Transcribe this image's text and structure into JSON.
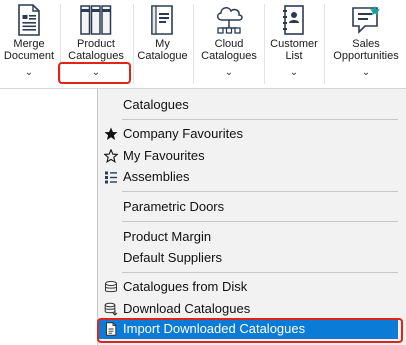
{
  "ribbon": {
    "buttons": [
      {
        "id": "merge",
        "label_line1": "Merge",
        "label_line2": "Document",
        "icon": "merge-document-icon"
      },
      {
        "id": "product",
        "label_line1": "Product",
        "label_line2": "Catalogues",
        "icon": "product-catalogues-icon"
      },
      {
        "id": "my",
        "label_line1": "My",
        "label_line2": "Catalogue",
        "icon": "my-catalogue-icon"
      },
      {
        "id": "cloud",
        "label_line1": "Cloud",
        "label_line2": "Catalogues",
        "icon": "cloud-catalogues-icon"
      },
      {
        "id": "customer",
        "label_line1": "Customer",
        "label_line2": "List",
        "icon": "customer-list-icon"
      },
      {
        "id": "sales",
        "label_line1": "Sales",
        "label_line2": "Opportunities",
        "icon": "sales-opportunities-icon"
      }
    ],
    "dropdown_arrow": "⌄"
  },
  "menu": {
    "header": "Catalogues",
    "items": [
      {
        "label": "Company Favourites",
        "icon": "star-filled-icon"
      },
      {
        "label": "My Favourites",
        "icon": "star-outline-icon"
      },
      {
        "label": "Assemblies",
        "icon": "assemblies-icon"
      },
      {
        "label": "Parametric Doors",
        "icon": ""
      },
      {
        "label": "Product Margin",
        "icon": ""
      },
      {
        "label": "Default Suppliers",
        "icon": ""
      },
      {
        "label": "Catalogues from Disk",
        "icon": "disk-icon"
      },
      {
        "label": "Download Catalogues",
        "icon": "download-database-icon"
      },
      {
        "label": "Import Downloaded Catalogues",
        "icon": "import-document-icon",
        "selected": true
      }
    ]
  },
  "colors": {
    "highlight_box": "#e2231a",
    "selected_bg": "#0a7bd6",
    "menu_bg": "#f2f2f2"
  }
}
